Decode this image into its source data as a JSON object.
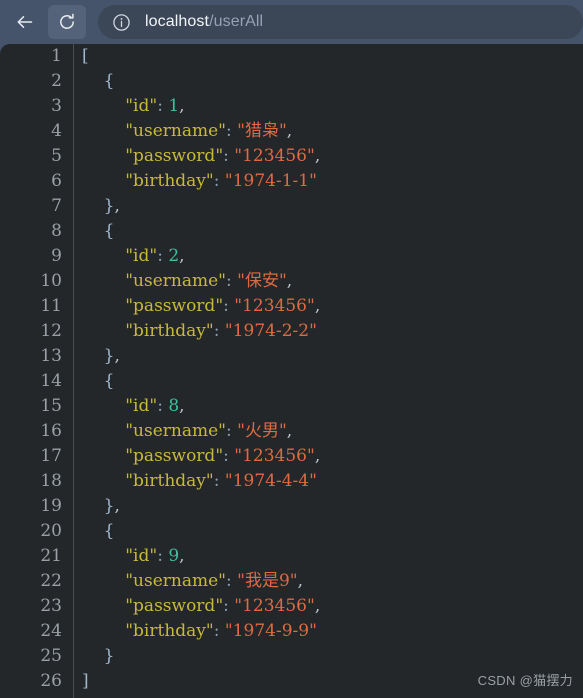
{
  "browser": {
    "back_icon": "arrow-left-icon",
    "reload_icon": "reload-icon",
    "omnibox": {
      "info_icon": "info-circle-icon",
      "url_host": "localhost",
      "url_path": "/userAll",
      "full_url": "localhost/userAll"
    }
  },
  "viewer": {
    "total_lines": 26,
    "line_numbers": [
      1,
      2,
      3,
      4,
      5,
      6,
      7,
      8,
      9,
      10,
      11,
      12,
      13,
      14,
      15,
      16,
      17,
      18,
      19,
      20,
      21,
      22,
      23,
      24,
      25,
      26
    ],
    "colors": {
      "background": "#242729",
      "chrome": "#46546b",
      "omnibox": "#3b4657",
      "key": "#c8b93a",
      "string": "#de6a42",
      "number": "#3fbf9f",
      "punctuation": "#bfc7d0",
      "brace": "#9fb6cd",
      "line_number": "#9aa0a6"
    },
    "json_records": [
      {
        "id": 1,
        "username": "猎枭",
        "password": "123456",
        "birthday": "1974-1-1"
      },
      {
        "id": 2,
        "username": "保安",
        "password": "123456",
        "birthday": "1974-2-2"
      },
      {
        "id": 8,
        "username": "火男",
        "password": "123456",
        "birthday": "1974-4-4"
      },
      {
        "id": 9,
        "username": "我是9",
        "password": "123456",
        "birthday": "1974-9-9"
      }
    ],
    "keys": [
      "id",
      "username",
      "password",
      "birthday"
    ],
    "lines": [
      {
        "n": 1,
        "tokens": [
          {
            "t": "[",
            "c": "brace"
          }
        ]
      },
      {
        "n": 2,
        "tokens": [
          {
            "t": "    ",
            "c": "punct"
          },
          {
            "t": "{",
            "c": "brace"
          }
        ]
      },
      {
        "n": 3,
        "tokens": [
          {
            "t": "        ",
            "c": "punct"
          },
          {
            "t": "\"id\"",
            "c": "key"
          },
          {
            "t": ": ",
            "c": "colon"
          },
          {
            "t": "1",
            "c": "num"
          },
          {
            "t": ",",
            "c": "punct"
          }
        ]
      },
      {
        "n": 4,
        "tokens": [
          {
            "t": "        ",
            "c": "punct"
          },
          {
            "t": "\"username\"",
            "c": "key"
          },
          {
            "t": ": ",
            "c": "colon"
          },
          {
            "t": "\"猎枭\"",
            "c": "str"
          },
          {
            "t": ",",
            "c": "punct"
          }
        ]
      },
      {
        "n": 5,
        "tokens": [
          {
            "t": "        ",
            "c": "punct"
          },
          {
            "t": "\"password\"",
            "c": "key"
          },
          {
            "t": ": ",
            "c": "colon"
          },
          {
            "t": "\"123456\"",
            "c": "str"
          },
          {
            "t": ",",
            "c": "punct"
          }
        ]
      },
      {
        "n": 6,
        "tokens": [
          {
            "t": "        ",
            "c": "punct"
          },
          {
            "t": "\"birthday\"",
            "c": "key"
          },
          {
            "t": ": ",
            "c": "colon"
          },
          {
            "t": "\"1974-1-1\"",
            "c": "str"
          }
        ]
      },
      {
        "n": 7,
        "tokens": [
          {
            "t": "    ",
            "c": "punct"
          },
          {
            "t": "}",
            "c": "brace"
          },
          {
            "t": ",",
            "c": "punct"
          }
        ]
      },
      {
        "n": 8,
        "tokens": [
          {
            "t": "    ",
            "c": "punct"
          },
          {
            "t": "{",
            "c": "brace"
          }
        ]
      },
      {
        "n": 9,
        "tokens": [
          {
            "t": "        ",
            "c": "punct"
          },
          {
            "t": "\"id\"",
            "c": "key"
          },
          {
            "t": ": ",
            "c": "colon"
          },
          {
            "t": "2",
            "c": "num"
          },
          {
            "t": ",",
            "c": "punct"
          }
        ]
      },
      {
        "n": 10,
        "tokens": [
          {
            "t": "        ",
            "c": "punct"
          },
          {
            "t": "\"username\"",
            "c": "key"
          },
          {
            "t": ": ",
            "c": "colon"
          },
          {
            "t": "\"保安\"",
            "c": "str"
          },
          {
            "t": ",",
            "c": "punct"
          }
        ]
      },
      {
        "n": 11,
        "tokens": [
          {
            "t": "        ",
            "c": "punct"
          },
          {
            "t": "\"password\"",
            "c": "key"
          },
          {
            "t": ": ",
            "c": "colon"
          },
          {
            "t": "\"123456\"",
            "c": "str"
          },
          {
            "t": ",",
            "c": "punct"
          }
        ]
      },
      {
        "n": 12,
        "tokens": [
          {
            "t": "        ",
            "c": "punct"
          },
          {
            "t": "\"birthday\"",
            "c": "key"
          },
          {
            "t": ": ",
            "c": "colon"
          },
          {
            "t": "\"1974-2-2\"",
            "c": "str"
          }
        ]
      },
      {
        "n": 13,
        "tokens": [
          {
            "t": "    ",
            "c": "punct"
          },
          {
            "t": "}",
            "c": "brace"
          },
          {
            "t": ",",
            "c": "punct"
          }
        ]
      },
      {
        "n": 14,
        "tokens": [
          {
            "t": "    ",
            "c": "punct"
          },
          {
            "t": "{",
            "c": "brace"
          }
        ]
      },
      {
        "n": 15,
        "tokens": [
          {
            "t": "        ",
            "c": "punct"
          },
          {
            "t": "\"id\"",
            "c": "key"
          },
          {
            "t": ": ",
            "c": "colon"
          },
          {
            "t": "8",
            "c": "num"
          },
          {
            "t": ",",
            "c": "punct"
          }
        ]
      },
      {
        "n": 16,
        "tokens": [
          {
            "t": "        ",
            "c": "punct"
          },
          {
            "t": "\"username\"",
            "c": "key"
          },
          {
            "t": ": ",
            "c": "colon"
          },
          {
            "t": "\"火男\"",
            "c": "str"
          },
          {
            "t": ",",
            "c": "punct"
          }
        ]
      },
      {
        "n": 17,
        "tokens": [
          {
            "t": "        ",
            "c": "punct"
          },
          {
            "t": "\"password\"",
            "c": "key"
          },
          {
            "t": ": ",
            "c": "colon"
          },
          {
            "t": "\"123456\"",
            "c": "str"
          },
          {
            "t": ",",
            "c": "punct"
          }
        ]
      },
      {
        "n": 18,
        "tokens": [
          {
            "t": "        ",
            "c": "punct"
          },
          {
            "t": "\"birthday\"",
            "c": "key"
          },
          {
            "t": ": ",
            "c": "colon"
          },
          {
            "t": "\"1974-4-4\"",
            "c": "str"
          }
        ]
      },
      {
        "n": 19,
        "tokens": [
          {
            "t": "    ",
            "c": "punct"
          },
          {
            "t": "}",
            "c": "brace"
          },
          {
            "t": ",",
            "c": "punct"
          }
        ]
      },
      {
        "n": 20,
        "tokens": [
          {
            "t": "    ",
            "c": "punct"
          },
          {
            "t": "{",
            "c": "brace"
          }
        ]
      },
      {
        "n": 21,
        "tokens": [
          {
            "t": "        ",
            "c": "punct"
          },
          {
            "t": "\"id\"",
            "c": "key"
          },
          {
            "t": ": ",
            "c": "colon"
          },
          {
            "t": "9",
            "c": "num"
          },
          {
            "t": ",",
            "c": "punct"
          }
        ]
      },
      {
        "n": 22,
        "tokens": [
          {
            "t": "        ",
            "c": "punct"
          },
          {
            "t": "\"username\"",
            "c": "key"
          },
          {
            "t": ": ",
            "c": "colon"
          },
          {
            "t": "\"我是9\"",
            "c": "str"
          },
          {
            "t": ",",
            "c": "punct"
          }
        ]
      },
      {
        "n": 23,
        "tokens": [
          {
            "t": "        ",
            "c": "punct"
          },
          {
            "t": "\"password\"",
            "c": "key"
          },
          {
            "t": ": ",
            "c": "colon"
          },
          {
            "t": "\"123456\"",
            "c": "str"
          },
          {
            "t": ",",
            "c": "punct"
          }
        ]
      },
      {
        "n": 24,
        "tokens": [
          {
            "t": "        ",
            "c": "punct"
          },
          {
            "t": "\"birthday\"",
            "c": "key"
          },
          {
            "t": ": ",
            "c": "colon"
          },
          {
            "t": "\"1974-9-9\"",
            "c": "str"
          }
        ]
      },
      {
        "n": 25,
        "tokens": [
          {
            "t": "    ",
            "c": "punct"
          },
          {
            "t": "}",
            "c": "brace"
          }
        ]
      },
      {
        "n": 26,
        "tokens": [
          {
            "t": "]",
            "c": "brace"
          }
        ]
      }
    ]
  },
  "watermark": {
    "text": "CSDN @猫摆力"
  }
}
